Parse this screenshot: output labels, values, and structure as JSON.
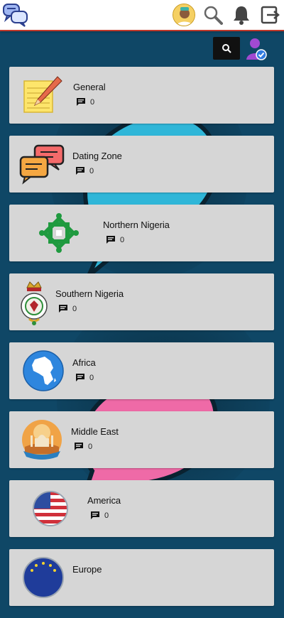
{
  "header": {
    "logo_icon": "chat-bubbles-logo-icon",
    "actions": [
      "profile-avatar",
      "search-icon",
      "bell-icon",
      "logout-icon"
    ]
  },
  "toolbar": {
    "search_icon": "search-icon",
    "user_icon": "verified-user-icon"
  },
  "categories": [
    {
      "name": "General",
      "count": "0",
      "icon": "notepad-pencil-icon"
    },
    {
      "name": "Dating Zone",
      "count": "0",
      "icon": "chat-bubbles-icon"
    },
    {
      "name": "Northern Nigeria",
      "count": "0",
      "icon": "green-knot-emblem-icon"
    },
    {
      "name": "Southern Nigeria",
      "count": "0",
      "icon": "coat-of-arms-icon"
    },
    {
      "name": "Africa",
      "count": "0",
      "icon": "africa-globe-icon"
    },
    {
      "name": "Middle East",
      "count": "0",
      "icon": "middle-east-landscape-icon"
    },
    {
      "name": "America",
      "count": "0",
      "icon": "us-flag-badge-icon"
    },
    {
      "name": "Europe",
      "count": "",
      "icon": "eu-flag-badge-icon"
    }
  ],
  "colors": {
    "background": "#0f4766",
    "card": "#d6d6d6",
    "header_border": "#c0392b",
    "decor_cyan": "#2fb6d8",
    "decor_pink": "#ef6aa7"
  }
}
